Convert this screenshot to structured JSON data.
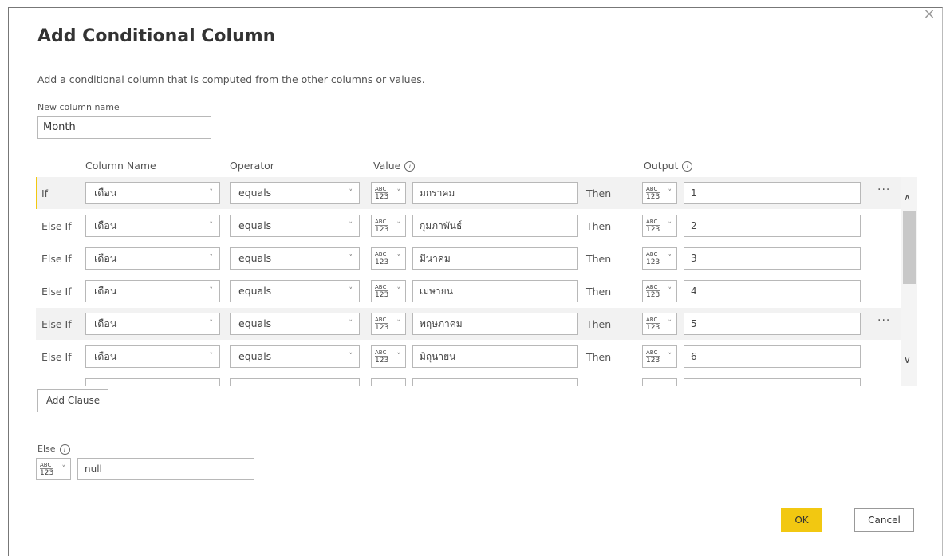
{
  "dialog": {
    "title": "Add Conditional Column",
    "description": "Add a conditional column that is computed from the other columns or values.",
    "close_glyph": "×",
    "new_column_label": "New column name",
    "new_column_value": "Month",
    "headers": {
      "column_name": "Column Name",
      "operator": "Operator",
      "value": "Value",
      "output": "Output",
      "info_glyph": "i"
    },
    "type_icon": {
      "top": "ABC",
      "bottom": "123",
      "caret": "˅"
    },
    "rows": [
      {
        "label": "If",
        "column": "เดือน",
        "operator": "equals",
        "value": "มกราคม",
        "then": "Then",
        "output": "1"
      },
      {
        "label": "Else If",
        "column": "เดือน",
        "operator": "equals",
        "value": "กุมภาพันธ์",
        "then": "Then",
        "output": "2"
      },
      {
        "label": "Else If",
        "column": "เดือน",
        "operator": "equals",
        "value": "มีนาคม",
        "then": "Then",
        "output": "3"
      },
      {
        "label": "Else If",
        "column": "เดือน",
        "operator": "equals",
        "value": "เมษายน",
        "then": "Then",
        "output": "4"
      },
      {
        "label": "Else If",
        "column": "เดือน",
        "operator": "equals",
        "value": "พฤษภาคม",
        "then": "Then",
        "output": "5"
      },
      {
        "label": "Else If",
        "column": "เดือน",
        "operator": "equals",
        "value": "มิถุนายน",
        "then": "Then",
        "output": "6"
      }
    ],
    "more_glyph": "···",
    "scroll_up_glyph": "∧",
    "scroll_down_glyph": "∨",
    "add_clause_label": "Add Clause",
    "else_label": "Else",
    "else_value": "null",
    "ok_label": "OK",
    "cancel_label": "Cancel",
    "accent_color": "#f2c811"
  }
}
